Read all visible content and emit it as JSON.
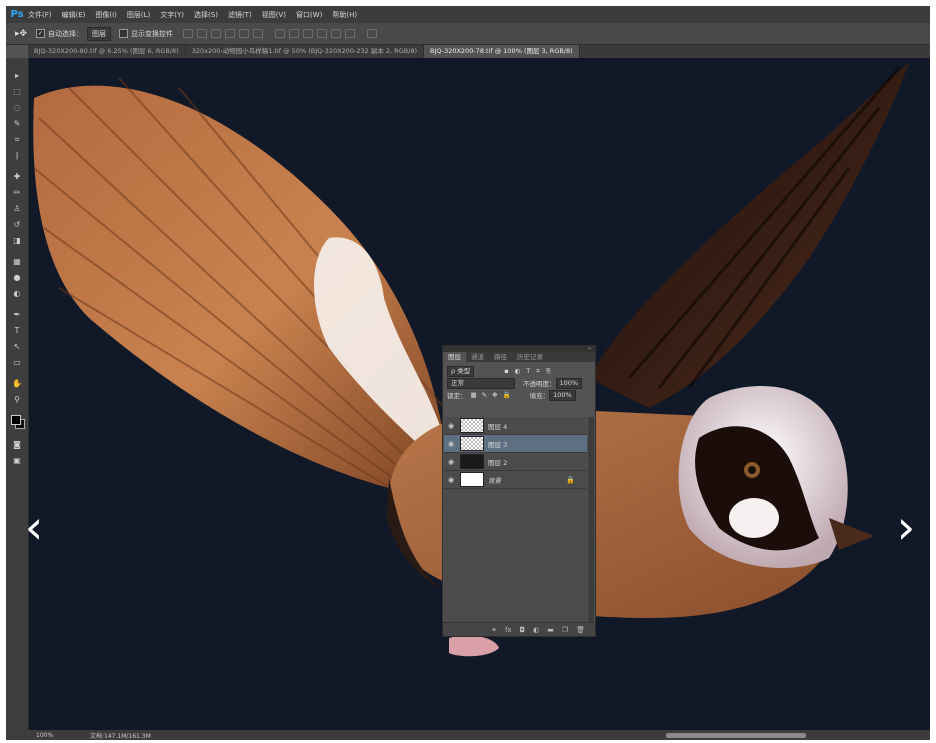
{
  "app": {
    "logo": "Ps"
  },
  "menu": [
    "文件(F)",
    "编辑(E)",
    "图像(I)",
    "图层(L)",
    "文字(Y)",
    "选择(S)",
    "滤镜(T)",
    "视图(V)",
    "窗口(W)",
    "帮助(H)"
  ],
  "options_bar": {
    "auto_select_label": "自动选择：",
    "auto_select_value": "图层",
    "show_transform_label": "显示变换控件"
  },
  "tabs": [
    {
      "label": "BJQ-320X200-80.tif @ 6.25% (图层 6, RGB/8)"
    },
    {
      "label": "320x200-动物园小鸟样稿1.tif @ 50% (BJQ-320X200-232 副本 2, RGB/8)"
    },
    {
      "label": "BJQ-320X200-78.tif @ 100% (图层 3, RGB/8)"
    }
  ],
  "layers_panel": {
    "tabs": [
      "图层",
      "通道",
      "路径",
      "历史记录"
    ],
    "filter_label": "ρ 类型",
    "blend_mode": "正常",
    "opacity_label": "不透明度：",
    "opacity_value": "100%",
    "lock_label": "锁定：",
    "fill_label": "填充：",
    "fill_value": "100%",
    "layers": [
      {
        "name": "图层 4",
        "thumb": "check"
      },
      {
        "name": "图层 3",
        "thumb": "check",
        "selected": true
      },
      {
        "name": "图层 2",
        "thumb": "dark"
      },
      {
        "name": "背景",
        "thumb": "white",
        "locked": true
      }
    ]
  },
  "status_bar": {
    "zoom": "100%",
    "doc_info": "文档:147.1M/161.3M"
  },
  "navigation": {
    "prev": "‹",
    "next": "›"
  }
}
